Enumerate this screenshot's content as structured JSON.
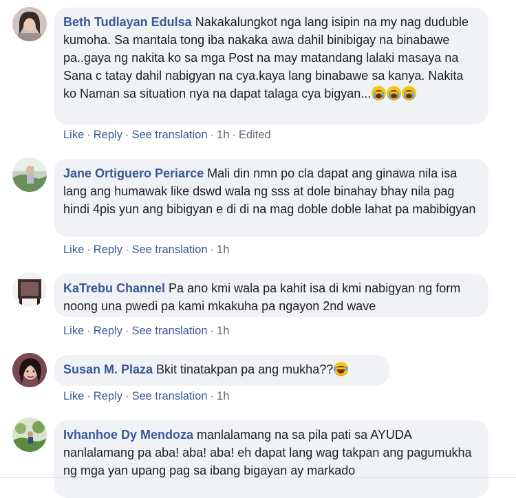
{
  "labels": {
    "like": "Like",
    "reply": "Reply",
    "see_translation": "See translation",
    "sep": "·"
  },
  "comments": [
    {
      "author": "Beth Tudlayan Edulsa",
      "text": "Nakakalungkot nga lang isipin na my nag duduble kumoha. Sa mantala tong iba nakaka awa dahil binibigay na binabawe pa..gaya ng nakita ko sa mga Post na may matandang lalaki masaya na Sana c tatay dahil nabigyan na cya.kaya lang binabawe sa kanya. Nakita ko Naman sa situation nya na dapat talaga cya bigyan...",
      "emoji": "crying-face-icon x3",
      "time": "1h",
      "edited": "Edited"
    },
    {
      "author": "Jane Ortiguero Periarce",
      "text": "Mali din nmn po cla dapat ang ginawa nila isa lang ang humawak like dswd wala ng sss at dole binahay bhay nila pag hindi 4pis yun ang bibigyan e di di na mag doble doble lahat pa mabibigyan",
      "time": "1h"
    },
    {
      "author": "KaTrebu Channel",
      "text": "Pa ano kmi wala pa kahit isa di kmi nabigyan ng form noong una pwedi pa kami mkakuha pa ngayon 2nd wave",
      "time": "1h"
    },
    {
      "author": "Susan M. Plaza",
      "text": "Bkit tinatakpan pa ang mukha??",
      "emoji": "laughing-crying-face-icon",
      "time": "1h"
    },
    {
      "author": "Ivhanhoe Dy Mendoza",
      "text": "manlalamang na sa pila pati sa AYUDA nanlalamang pa aba! aba! aba! eh dapat lang wag takpan ang pagumukha ng mga yan upang pag sa ibang bigayan ay markado"
    }
  ]
}
